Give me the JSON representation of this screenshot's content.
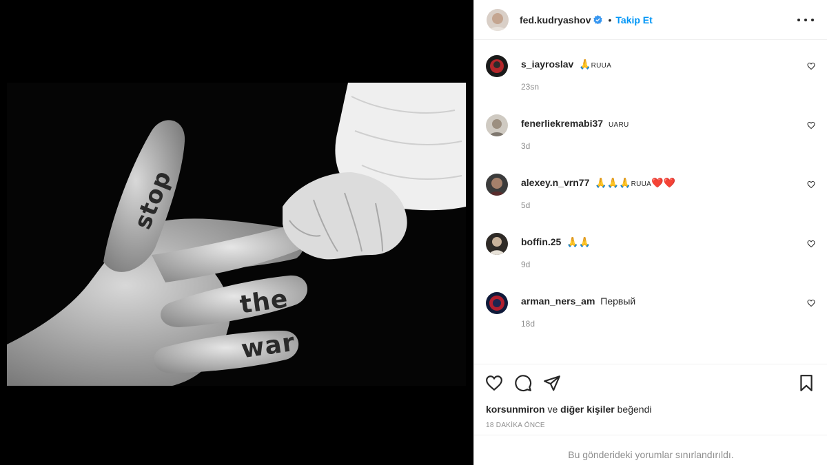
{
  "post": {
    "author": "fed.kudryashov",
    "follow_label": "Takip Et",
    "separator": "•",
    "image_words": [
      "stop",
      "the",
      "war"
    ]
  },
  "comments": [
    {
      "user": "s_iayroslav",
      "text": "🙏",
      "suffix": "RUUA",
      "time": "23sn"
    },
    {
      "user": "fenerliekremabi37",
      "text": "",
      "suffix": "UARU",
      "time": "3d"
    },
    {
      "user": "alexey.n_vrn77",
      "text": "🙏🙏🙏",
      "suffix": "RUUA",
      "text2": "❤️❤️",
      "time": "5d"
    },
    {
      "user": "boffin.25",
      "text": "🙏🙏",
      "suffix": "",
      "time": "9d"
    },
    {
      "user": "arman_ners_am",
      "text": "Первый",
      "suffix": "",
      "time": "18d"
    }
  ],
  "likes": {
    "first_user": "korsunmiron",
    "conjunction": "ve",
    "others": "diğer kişiler",
    "verb": "beğendi"
  },
  "time_ago": "18 DAKİKA ÖNCE",
  "comments_limited": "Bu gönderideki yorumlar sınırlandırıldı.",
  "colors": {
    "accent": "#0095f6",
    "verified": "#3897f0",
    "muted": "#8e8e8e"
  }
}
